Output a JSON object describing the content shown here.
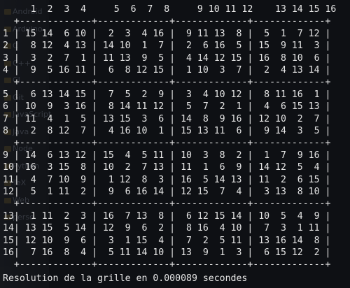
{
  "background_ghost": {
    "items": [
      "Android",
      "Arduino",
      "C",
      "C++",
      "CI",
      "Git",
      "JavaScript",
      "Java",
      "Node",
      "Python",
      "TeX",
      "Web",
      "perso"
    ]
  },
  "terminal": {
    "lines": [
      "     1  2  3  4     5  6  7  8     9 10 11 12    13 14 15 16",
      "  +-------------+-------------+-------------+-------------+",
      "1 | 15 14  6 10 |  2  3  4 16 |  9 11 13  8 |  5  1  7 12 |",
      "2 |  8 12  4 13 | 14 10  1  7 |  2  6 16  5 | 15  9 11  3 |",
      "3 |  3  2  7  1 | 11 13  9  5 |  4 14 12 15 | 16  8 10  6 |",
      "4 |  9  5 16 11 |  6  8 12 15 |  1 10  3  7 |  2  4 13 14 |",
      "  +-------------+-------------+-------------+-------------+",
      "5 |  6 13 14 15 |  7  5  2  9 |  3  4 10 12 |  8 11 16  1 |",
      "6 | 10  9  3 16 |  8 14 11 12 |  5  7  2  1 |  4  6 15 13 |",
      "7 | 11  4  1  5 | 13 15  3  6 | 14  8  9 16 | 12 10  2  7 |",
      "8 |  2  8 12  7 |  4 16 10  1 | 15 13 11  6 |  9 14  3  5 |",
      "  +-------------+-------------+-------------+-------------+",
      "9 | 14  6 13 12 | 15  4  5 11 | 10  3  8  2 |  1  7  9 16 |",
      "10| 16  3 15  8 | 10  2  7 13 | 11  1  6  9 | 14 12  5  4 |",
      "11|  4  7 10  9 |  1 12  8  3 | 16  5 14 13 | 11  2  6 15 |",
      "12|  5  1 11  2 |  9  6 16 14 | 12 15  7  4 |  3 13  8 10 |",
      "  +-------------+-------------+-------------+-------------+",
      "13|  1 11  2  3 | 16  7 13  8 |  6 12 15 14 | 10  5  4  9 |",
      "14| 13 15  5 14 | 12  9  6  2 |  8 16  4 10 |  7  3  1 11 |",
      "15| 12 10  9  6 |  3  1 15  4 |  7  2  5 11 | 13 16 14  8 |",
      "16|  7 16  8  4 |  5 11 14 10 | 13  9  1  3 |  6 15 12  2 |",
      "  +-------------+-------------+-------------+-------------+"
    ],
    "status": "Resolution de la grille en 0.000089 secondes"
  }
}
